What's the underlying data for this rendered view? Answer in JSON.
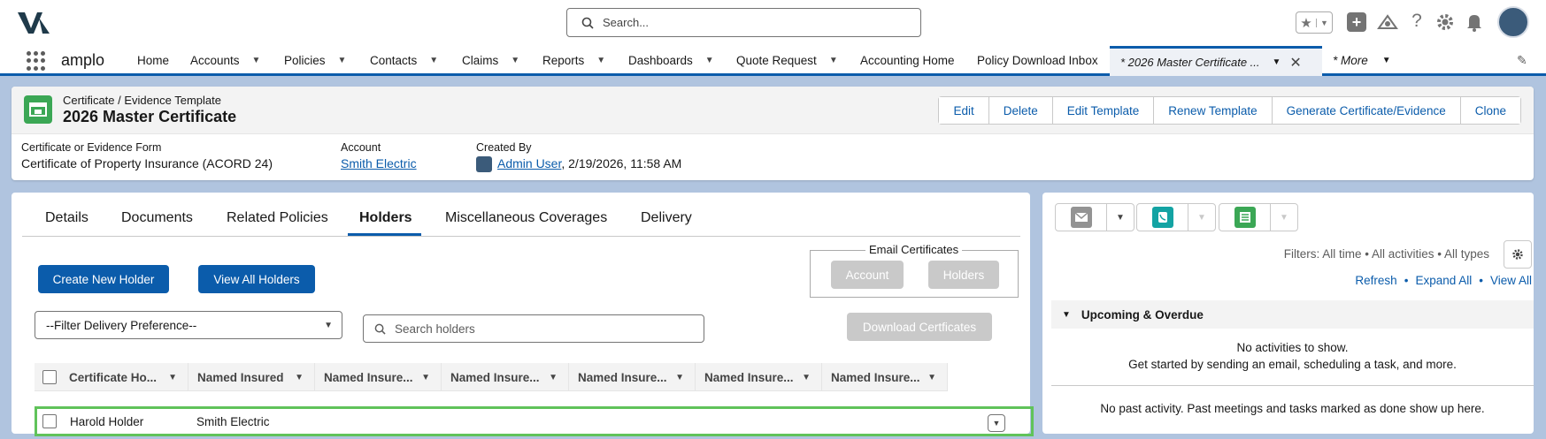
{
  "global": {
    "search_placeholder": "Search...",
    "app_name": "amplo"
  },
  "nav": {
    "items": [
      {
        "label": "Home",
        "dropdown": false
      },
      {
        "label": "Accounts",
        "dropdown": true
      },
      {
        "label": "Policies",
        "dropdown": true
      },
      {
        "label": "Contacts",
        "dropdown": true
      },
      {
        "label": "Claims",
        "dropdown": true
      },
      {
        "label": "Reports",
        "dropdown": true
      },
      {
        "label": "Dashboards",
        "dropdown": true
      },
      {
        "label": "Quote Request",
        "dropdown": true
      },
      {
        "label": "Accounting Home",
        "dropdown": false
      },
      {
        "label": "Policy Download Inbox",
        "dropdown": false
      }
    ],
    "active_tab": "* 2026 Master Certificate ...",
    "more": "* More"
  },
  "record": {
    "object_type": "Certificate / Evidence Template",
    "name": "2026 Master Certificate",
    "actions": [
      "Edit",
      "Delete",
      "Edit Template",
      "Renew Template",
      "Generate Certificate/Evidence",
      "Clone"
    ],
    "fields": {
      "form_label": "Certificate or Evidence Form",
      "form_value": "Certificate of Property Insurance (ACORD 24)",
      "account_label": "Account",
      "account_value": "Smith Electric",
      "created_label": "Created By",
      "created_user": "Admin User",
      "created_date": ", 2/19/2026, 11:58 AM"
    }
  },
  "tabs": [
    "Details",
    "Documents",
    "Related Policies",
    "Holders",
    "Miscellaneous Coverages",
    "Delivery"
  ],
  "active_tab_index": 3,
  "holders": {
    "create_button": "Create New Holder",
    "view_all_button": "View All Holders",
    "email_legend": "Email Certificates",
    "email_account": "Account",
    "email_holders": "Holders",
    "filter_select": "--Filter Delivery Preference--",
    "search_placeholder": "Search holders",
    "download_button": "Download Certficates",
    "columns": [
      "Certificate Ho...",
      "Named Insured",
      "Named Insure...",
      "Named Insure...",
      "Named Insure...",
      "Named Insure...",
      "Named Insure..."
    ],
    "rows": [
      {
        "holder": "Harold Holder",
        "named_insured": "Smith Electric"
      }
    ]
  },
  "activity": {
    "filters": "Filters: All time • All activities • All types",
    "refresh": "Refresh",
    "expand_all": "Expand All",
    "view_all": "View All",
    "upcoming_title": "Upcoming & Overdue",
    "no_activities": "No activities to show.",
    "get_started": "Get started by sending an email, scheduling a task, and more.",
    "no_past": "No past activity. Past meetings and tasks marked as done show up here."
  },
  "colors": {
    "brand": "#0b5cab",
    "success": "#3ba755",
    "highlight": "#60c35a",
    "background": "#b0c4df"
  }
}
